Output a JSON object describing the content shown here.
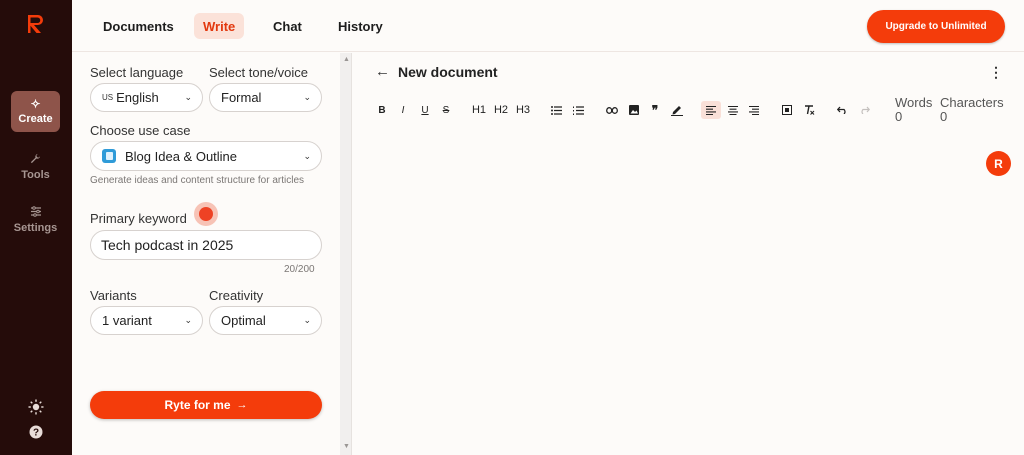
{
  "rail": {
    "items": [
      {
        "label": "Create",
        "icon": "sparkles-icon"
      },
      {
        "label": "Tools",
        "icon": "wrench-icon"
      },
      {
        "label": "Settings",
        "icon": "sliders-icon"
      }
    ]
  },
  "topbar": {
    "tabs": [
      {
        "label": "Documents"
      },
      {
        "label": "Write"
      },
      {
        "label": "Chat"
      },
      {
        "label": "History"
      }
    ],
    "upgrade_label": "Upgrade to Unlimited"
  },
  "panel": {
    "language_label": "Select language",
    "language_flag": "US",
    "language_value": "English",
    "tone_label": "Select tone/voice",
    "tone_value": "Formal",
    "use_case_label": "Choose use case",
    "use_case_value": "Blog Idea & Outline",
    "use_case_hint": "Generate ideas and content structure for articles",
    "keyword_label": "Primary keyword",
    "keyword_value": "Tech podcast in 2025",
    "keyword_counter": "20/200",
    "variants_label": "Variants",
    "variants_value": "1 variant",
    "creativity_label": "Creativity",
    "creativity_value": "Optimal",
    "ryte_button": "Ryte for me"
  },
  "editor": {
    "title": "New document",
    "words_label": "Words",
    "words_value": "0",
    "chars_label": "Characters",
    "chars_value": "0",
    "toolbar": {
      "bold": "B",
      "italic": "I",
      "underline": "U",
      "strike": "S",
      "h1": "H1",
      "h2": "H2",
      "h3": "H3",
      "quote": "❞"
    },
    "badge_letter": "R"
  },
  "colors": {
    "accent": "#f43c0b",
    "rail_bg": "#250c0a",
    "rail_active": "#8e544a",
    "tab_active_bg": "#fbe2d9"
  }
}
